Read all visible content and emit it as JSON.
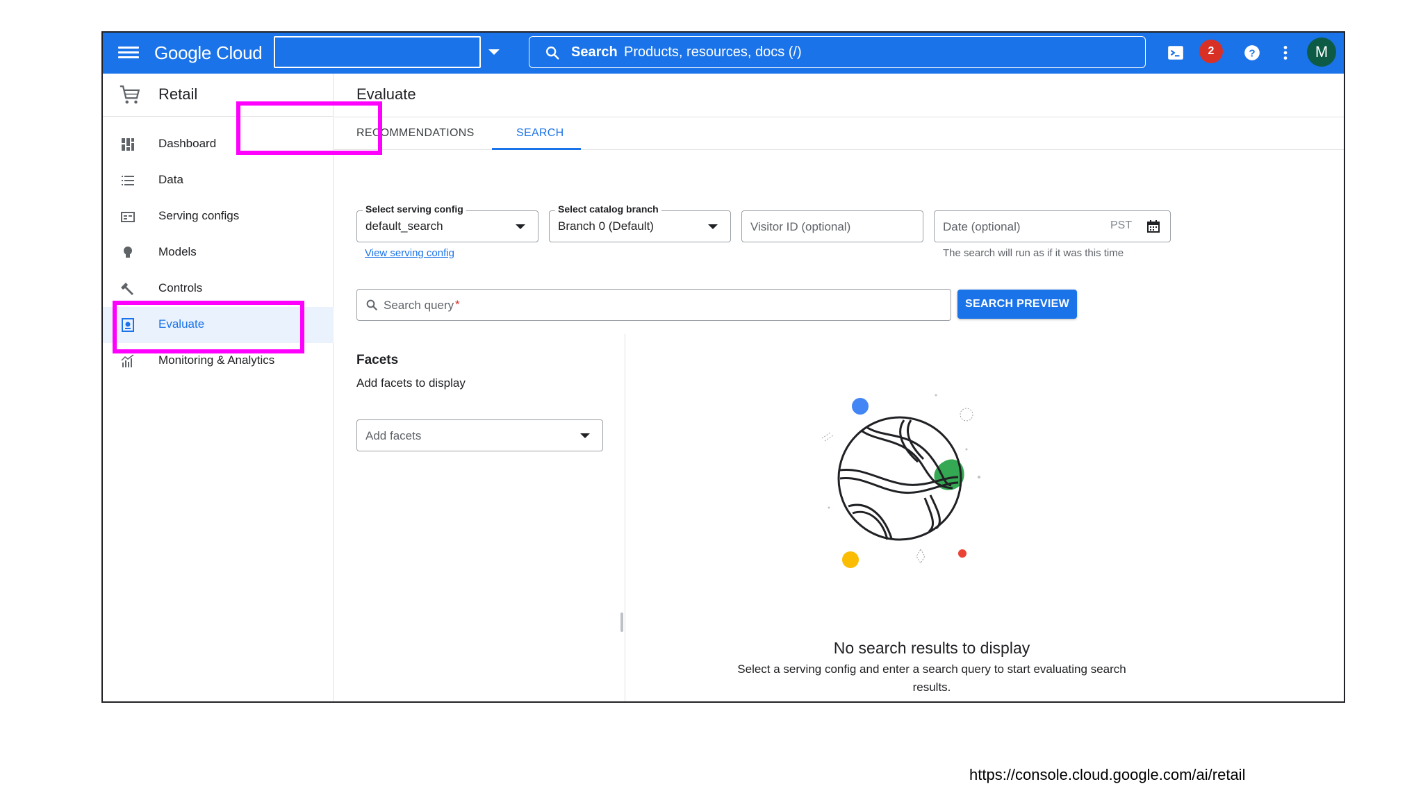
{
  "topbar": {
    "brand": "Google Cloud",
    "search_label": "Search",
    "search_placeholder": "Products, resources, docs (/)",
    "notification_count": "2",
    "avatar_initial": "M"
  },
  "sidebar": {
    "product_title": "Retail",
    "items": [
      {
        "label": "Dashboard",
        "icon": "dashboard-icon"
      },
      {
        "label": "Data",
        "icon": "list-icon"
      },
      {
        "label": "Serving configs",
        "icon": "serving-config-icon"
      },
      {
        "label": "Models",
        "icon": "lightbulb-icon"
      },
      {
        "label": "Controls",
        "icon": "wrench-icon"
      },
      {
        "label": "Evaluate",
        "icon": "evaluate-icon",
        "active": true
      },
      {
        "label": "Monitoring & Analytics",
        "icon": "analytics-icon"
      }
    ]
  },
  "main": {
    "title": "Evaluate",
    "tabs": [
      {
        "label": "RECOMMENDATIONS"
      },
      {
        "label": "SEARCH",
        "active": true
      }
    ],
    "serving_config": {
      "label": "Select serving config",
      "value": "default_search",
      "link": "View serving config"
    },
    "catalog_branch": {
      "label": "Select catalog branch",
      "value": "Branch 0 (Default)"
    },
    "visitor_id": {
      "placeholder": "Visitor ID (optional)"
    },
    "date": {
      "placeholder": "Date (optional)",
      "timezone": "PST",
      "hint": "The search will run as if it was this time"
    },
    "search_query": {
      "placeholder": "Search query",
      "required_mark": "*"
    },
    "search_button": "SEARCH PREVIEW",
    "facets": {
      "title": "Facets",
      "subtitle": "Add facets to display",
      "select_placeholder": "Add facets"
    },
    "empty_state": {
      "title": "No search results to display",
      "subtitle": "Select a serving config and enter a search query to start evaluating search results."
    }
  },
  "footer_url": "https://console.cloud.google.com/ai/retail",
  "colors": {
    "brand_blue": "#1a73e8",
    "highlight": "#ff00ff",
    "badge_red": "#d93025",
    "avatar_green": "#0d5b45"
  }
}
